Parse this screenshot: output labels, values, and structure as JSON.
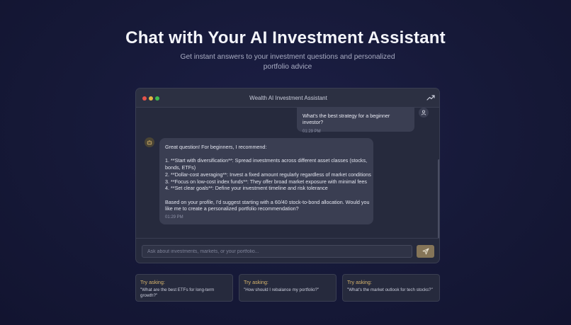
{
  "hero": {
    "title": "Chat with Your AI Investment Assistant",
    "subtitle": "Get instant answers to your investment questions and personalized portfolio advice"
  },
  "window": {
    "title": "Wealth AI Investment Assistant",
    "icon": "trending-up-icon"
  },
  "messages": {
    "user": {
      "text": "What's the best strategy for a beginner investor?",
      "time": "01:29 PM"
    },
    "bot": {
      "lines": [
        "Great question! For beginners, I recommend:",
        "",
        "1. **Start with diversification**: Spread investments across different asset classes (stocks,",
        "bonds, ETFs)",
        "2. **Dollar-cost averaging**: Invest a fixed amount regularly regardless of market conditions",
        "3. **Focus on low-cost index funds**: They offer broad market exposure with minimal fees",
        "4. **Set clear goals**: Define your investment timeline and risk tolerance",
        "",
        "Based on your profile, I'd suggest starting with a 60/40 stock-to-bond allocation. Would you",
        "like me to create a personalized portfolio recommendation?"
      ],
      "time": "01:29 PM"
    }
  },
  "input": {
    "placeholder": "Ask about investments, markets, or your portfolio...",
    "value": ""
  },
  "suggestions": [
    {
      "label": "Try asking:",
      "question": "\"What are the best ETFs for long-term growth?\""
    },
    {
      "label": "Try asking:",
      "question": "\"How should I rebalance my portfolio?\""
    },
    {
      "label": "Try asking:",
      "question": "\"What's the market outlook for tech stocks?\""
    }
  ],
  "colors": {
    "background": "#161938",
    "panel": "#262a3d",
    "bubble": "#3a3e52",
    "accent_gold": "#d9b66d",
    "send_button": "#857558"
  }
}
